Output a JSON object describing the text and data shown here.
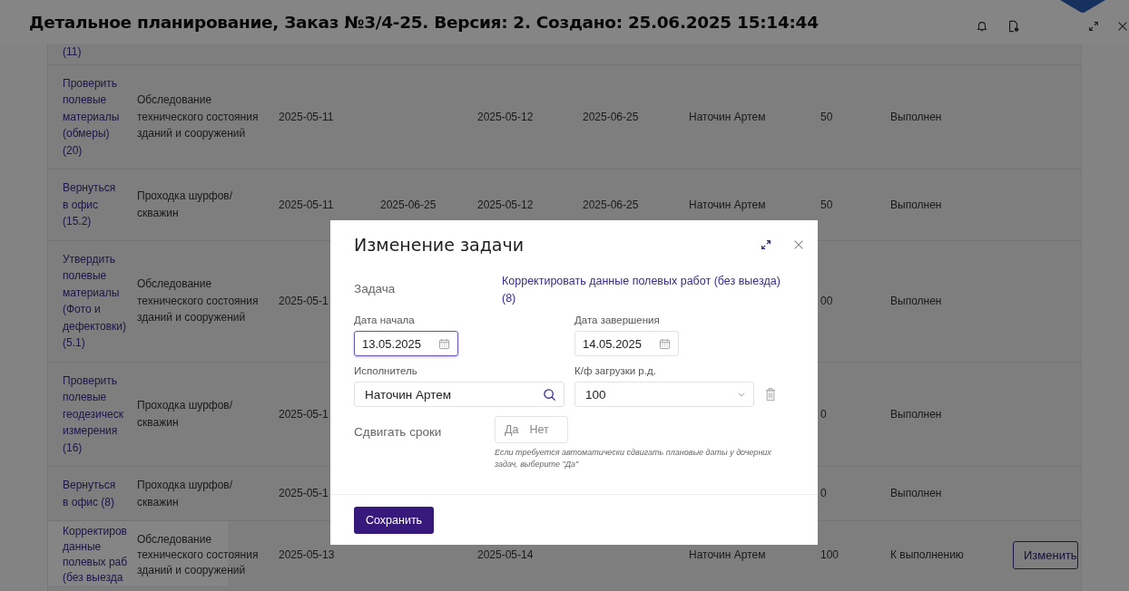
{
  "window": {
    "title": "Детальное планирование, Заказ №3/4-25. Версия: 2. Создано: 25.06.2025 15:14:44"
  },
  "table": {
    "rows": [
      {
        "selected": false,
        "column_1": "(11)"
      },
      {
        "selected": false,
        "column_1": "Проверить\nполевые\nматериалы\n(обмеры)\n(20)",
        "column_2": "Обследование\nтехнического состояния\nзданий и сооружений",
        "column_3": "2025-05-11",
        "column_5": "2025-05-12",
        "column_6": "2025-06-25",
        "column_7": "Наточин Артем",
        "column_8": "50",
        "column_9": "Выполнен"
      },
      {
        "selected": false,
        "column_1": "Вернуться\nв офис\n(15.2)",
        "column_2": "Проходка шурфов/\nскважин",
        "column_3": "2025-05-11",
        "column_4": "2025-06-25",
        "column_5": "2025-05-12",
        "column_6": "2025-06-25",
        "column_7": "Наточин Артем",
        "column_8": "50",
        "column_9": "Выполнен"
      },
      {
        "selected": false,
        "column_1": "Утвердить\nполевые\nматериалы\n(Фото и\nдефектовки)\n(5.1)",
        "column_2": "Обследование\nтехнического состояния\nзданий и сооружений",
        "column_3": "2025-05-1",
        "column_8": "00",
        "column_9": "Выполнен"
      },
      {
        "selected": false,
        "column_1": "Проверить\nполевые\nгеодезическ\nизмерения\n(16)",
        "column_2": "Проходка шурфов/\nскважин",
        "column_3": "2025-05-1",
        "column_8": "0",
        "column_9": "Выполнен"
      },
      {
        "selected": false,
        "column_1": "Вернуться\nв офис (8)",
        "column_2": "Проходка шурфов/\nскважин",
        "column_3": "2025-05-1",
        "column_8": "0",
        "column_9": "Выполнен"
      },
      {
        "selected": true,
        "column_1": "Корректиров\nданные\nполевых раб\n(без выезда",
        "column_2": "Обследование\nтехнического состояния\nзданий и сооружений",
        "column_3": "2025-05-13",
        "column_5": "2025-05-14",
        "column_7": "Наточин Артем",
        "column_8": "100",
        "column_9": "К выполнению",
        "button": "Изменить"
      }
    ]
  },
  "dialog": {
    "title": "Изменение задачи",
    "task": {
      "label": "Задача",
      "value": "Корректировать данные полевых работ (без выезда)\n(8)"
    },
    "start_date": {
      "label": "Дата начала",
      "value": "13.05.2025",
      "focused": true
    },
    "end_date": {
      "label": "Дата завершения",
      "value": "14.05.2025",
      "focused": false
    },
    "executor": {
      "label": "Исполнитель",
      "value": "Наточин Артем"
    },
    "load_factor": {
      "label": "К/ф загрузки р.д.",
      "value": "100"
    },
    "shift_dates": {
      "label": "Сдвигать сроки",
      "options": [
        {
          "label": "Да",
          "selected": false
        },
        {
          "label": "Нет",
          "selected": false
        }
      ],
      "hint": "Если требуется автоматически сдвигать плановые даты у дочерних задач, выберите \"Да\""
    },
    "buttons": [
      "Сохранить"
    ]
  }
}
